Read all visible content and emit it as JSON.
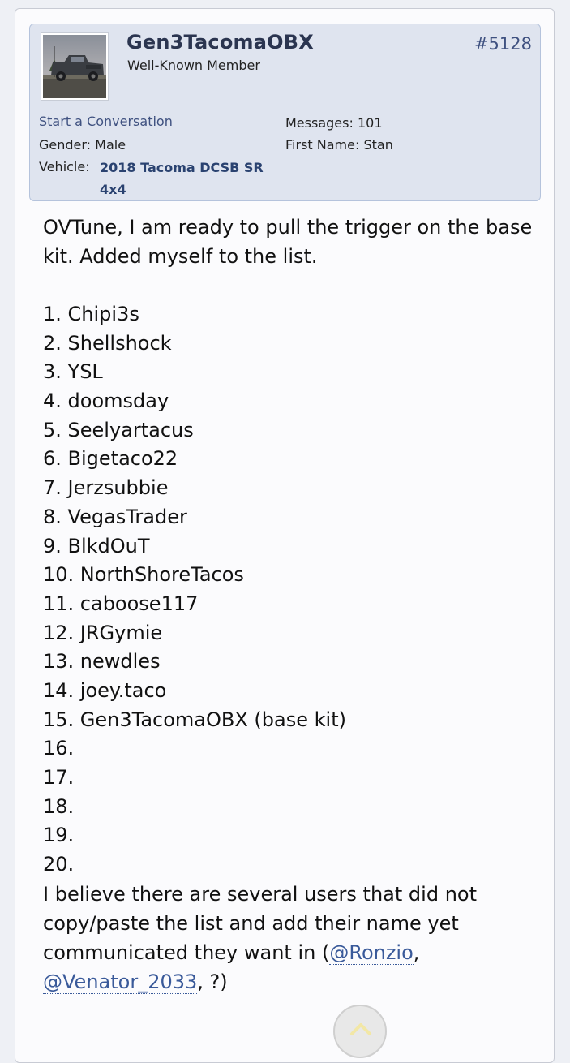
{
  "post": {
    "username": "Gen3TacomaOBX",
    "user_title": "Well-Known Member",
    "post_number": "#5128",
    "start_conversation": "Start a Conversation",
    "gender_label": "Gender:",
    "gender_value": "Male",
    "vehicle_label": "Vehicle:",
    "vehicle_value": "2018 Tacoma DCSB SR 4x4",
    "messages_label": "Messages:",
    "messages_value": "101",
    "first_name_label": "First Name:",
    "first_name_value": "Stan"
  },
  "body": {
    "intro": "OVTune, I am ready to pull the trigger on the base kit. Added myself to the list.",
    "list": [
      "1. Chipi3s",
      "2. Shellshock",
      "3. YSL",
      "4. doomsday",
      "5. Seelyartacus",
      "6. Bigetaco22",
      "7. Jerzsubbie",
      "8. VegasTrader",
      "9. BlkdOuT",
      "10. NorthShoreTacos",
      "11. caboose117",
      "12. JRGymie",
      "13. newdles",
      "14. joey.taco",
      "15. Gen3TacomaOBX (base kit)",
      "16.",
      "17.",
      "18.",
      "19.",
      "20."
    ],
    "closing_text": "I believe there are several users that did not copy/paste the list and add their name yet communicated they want in (",
    "mention_1": "@Ronzio",
    "separator": ", ",
    "mention_2": "@Venator_2033",
    "closing_end": ", ?)"
  },
  "icons": {
    "scroll_top": "chevron-up-icon",
    "avatar": "truck-photo"
  },
  "colors": {
    "username": "#2b3550",
    "link": "#3f5180",
    "userinfo_bg": "#dfe4ef",
    "mention": "#3a5a9a"
  }
}
